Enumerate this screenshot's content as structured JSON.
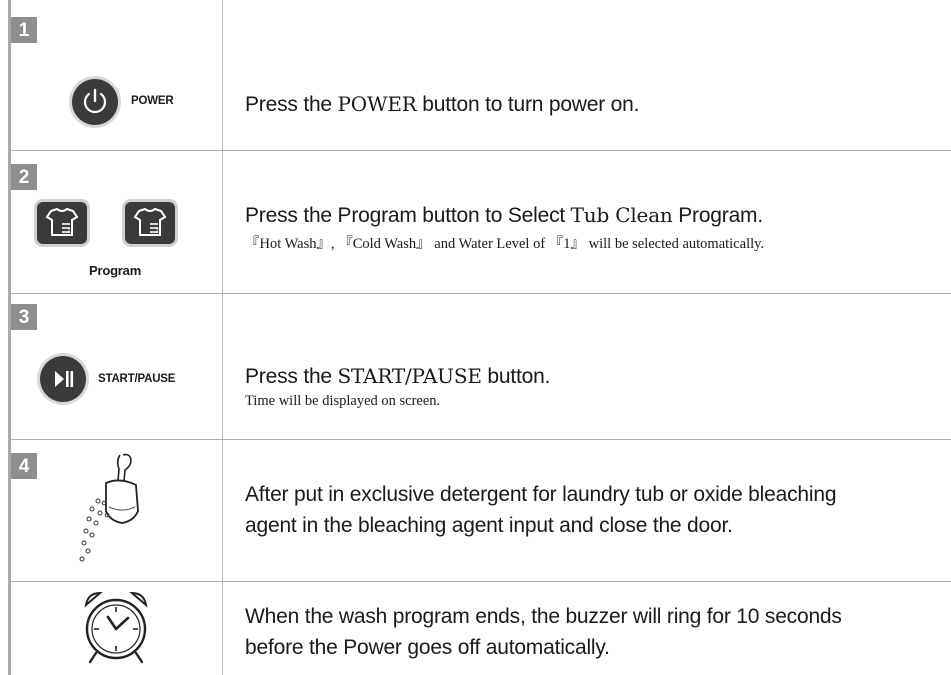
{
  "steps": [
    {
      "number": "1",
      "control_label": "POWER",
      "text_before": "Press the ",
      "text_bold": "POWER",
      "text_after": " button to turn power on."
    },
    {
      "number": "2",
      "control_label": "Program",
      "text_before": "Press the Program button to Select ",
      "text_bold": "Tub Clean",
      "text_after": " Program.",
      "note": "『Hot Wash』, 『Cold Wash』 and Water Level of 『1』 will be selected automatically."
    },
    {
      "number": "3",
      "control_label": "START/PAUSE",
      "text_before": "Press the ",
      "text_bold": "START/PAUSE",
      "text_after": " button.",
      "note": "Time will be displayed on screen."
    },
    {
      "number": "4",
      "line1": "After put in exclusive detergent for laundry tub or oxide bleaching",
      "line2": "agent in the bleaching agent input and close the door."
    },
    {
      "line1": "When the wash program ends, the buzzer will ring for 10 seconds",
      "line2": "before the Power goes off automatically."
    }
  ],
  "icons": {
    "power": "power-icon",
    "program": "shirt-program-icon",
    "start_pause": "play-pause-icon",
    "detergent": "detergent-scoop-icon",
    "alarm": "alarm-clock-icon"
  },
  "colors": {
    "button_dark": "#3b3b3b",
    "step_badge": "#8e8e8e"
  }
}
